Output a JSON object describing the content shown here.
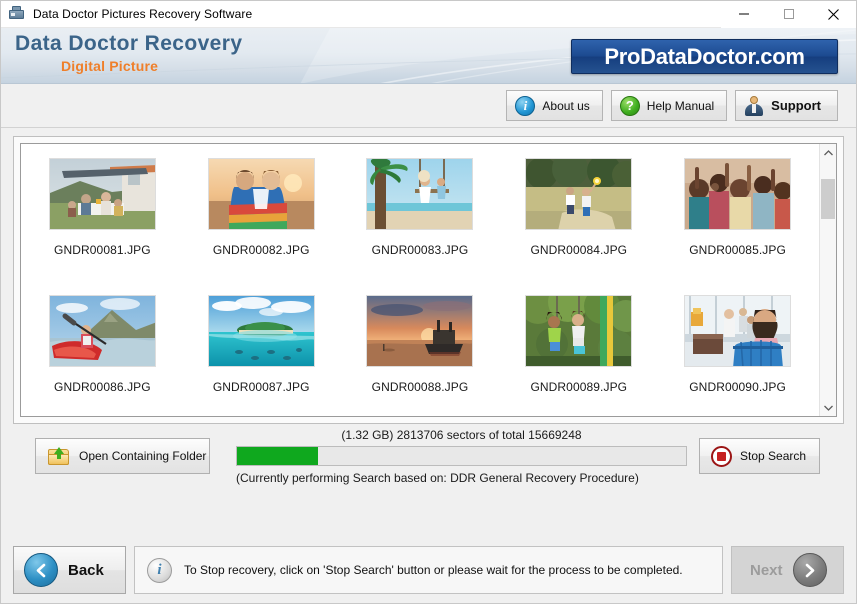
{
  "window": {
    "title": "Data Doctor Pictures Recovery Software",
    "icon": "app-icon",
    "controls": {
      "minimize": "minimize-icon",
      "maximize": "maximize-icon",
      "close": "close-icon"
    }
  },
  "banner": {
    "title": "Data Doctor Recovery",
    "subtitle": "Digital Picture",
    "brand": "ProDataDoctor.com"
  },
  "toolbar": {
    "about_label": "About us",
    "about_icon": "info-icon",
    "help_label": "Help Manual",
    "help_icon": "question-icon",
    "support_label": "Support",
    "support_icon": "person-icon"
  },
  "thumbnails": [
    {
      "name": "GNDR00081.JPG",
      "alt": "family picnic by camper van"
    },
    {
      "name": "GNDR00082.JPG",
      "alt": "two women wrapped in rainbow blanket at sunset"
    },
    {
      "name": "GNDR00083.JPG",
      "alt": "woman on beach swing under palm tree"
    },
    {
      "name": "GNDR00084.JPG",
      "alt": "two children running in field with sparkler"
    },
    {
      "name": "GNDR00085.JPG",
      "alt": "crowd of people dancing with raised arms"
    },
    {
      "name": "GNDR00086.JPG",
      "alt": "woman kayaking in red kayak"
    },
    {
      "name": "GNDR00087.JPG",
      "alt": "tropical island split underwater view"
    },
    {
      "name": "GNDR00088.JPG",
      "alt": "fishing boat at sunset on calm water"
    },
    {
      "name": "GNDR00089.JPG",
      "alt": "two girls on swings in woodland"
    },
    {
      "name": "GNDR00090.JPG",
      "alt": "girl leaning on blue suitcase at airport"
    }
  ],
  "scrollbar": {
    "up_icon": "chevron-up-icon",
    "down_icon": "chevron-down-icon",
    "thumb_position_percent": 9
  },
  "actions": {
    "open_folder_label": "Open Containing Folder",
    "open_folder_icon": "folder-upload-icon",
    "stop_search_label": "Stop Search",
    "stop_search_icon": "stop-icon"
  },
  "progress": {
    "top_text": "(1.32 GB) 2813706  sectors  of  total 15669248",
    "size_label": "1.32 GB",
    "sectors_done": 2813706,
    "sectors_total": 15669248,
    "percent": 18,
    "fill_color": "#0fa81e",
    "bottom_text": "(Currently performing Search based on:  DDR General Recovery Procedure)",
    "procedure": "DDR General Recovery Procedure"
  },
  "footer": {
    "back_label": "Back",
    "back_icon": "chevron-left-icon",
    "next_label": "Next",
    "next_icon": "chevron-right-icon",
    "next_disabled": true,
    "status_icon": "info-icon",
    "status_text": "To Stop recovery, click on 'Stop Search' button or please wait for the process to be completed."
  }
}
